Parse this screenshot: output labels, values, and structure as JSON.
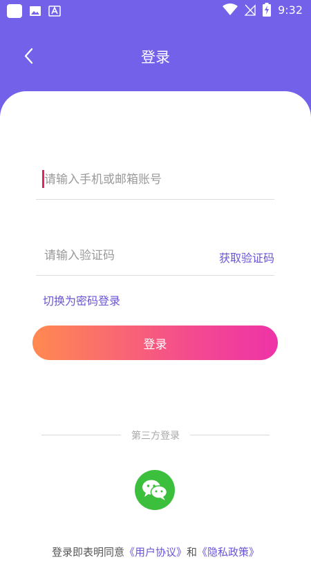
{
  "status_bar": {
    "time": "9:32"
  },
  "header": {
    "title": "登录"
  },
  "form": {
    "account_placeholder": "请输入手机或邮箱账号",
    "code_placeholder": "请输入验证码",
    "get_code_label": "获取验证码",
    "switch_label": "切换为密码登录",
    "login_label": "登录"
  },
  "third_party": {
    "label": "第三方登录"
  },
  "agreement": {
    "prefix": "登录即表明同意",
    "user_agreement": "《用户协议》",
    "connector": "和",
    "privacy_policy": "《隐私政策》"
  },
  "colors": {
    "header_bg": "#7361ea",
    "accent": "#6b53d8",
    "button_gradient_start": "#ff8a50",
    "button_gradient_end": "#ee33a8",
    "wechat_green": "#3cbf3c"
  }
}
